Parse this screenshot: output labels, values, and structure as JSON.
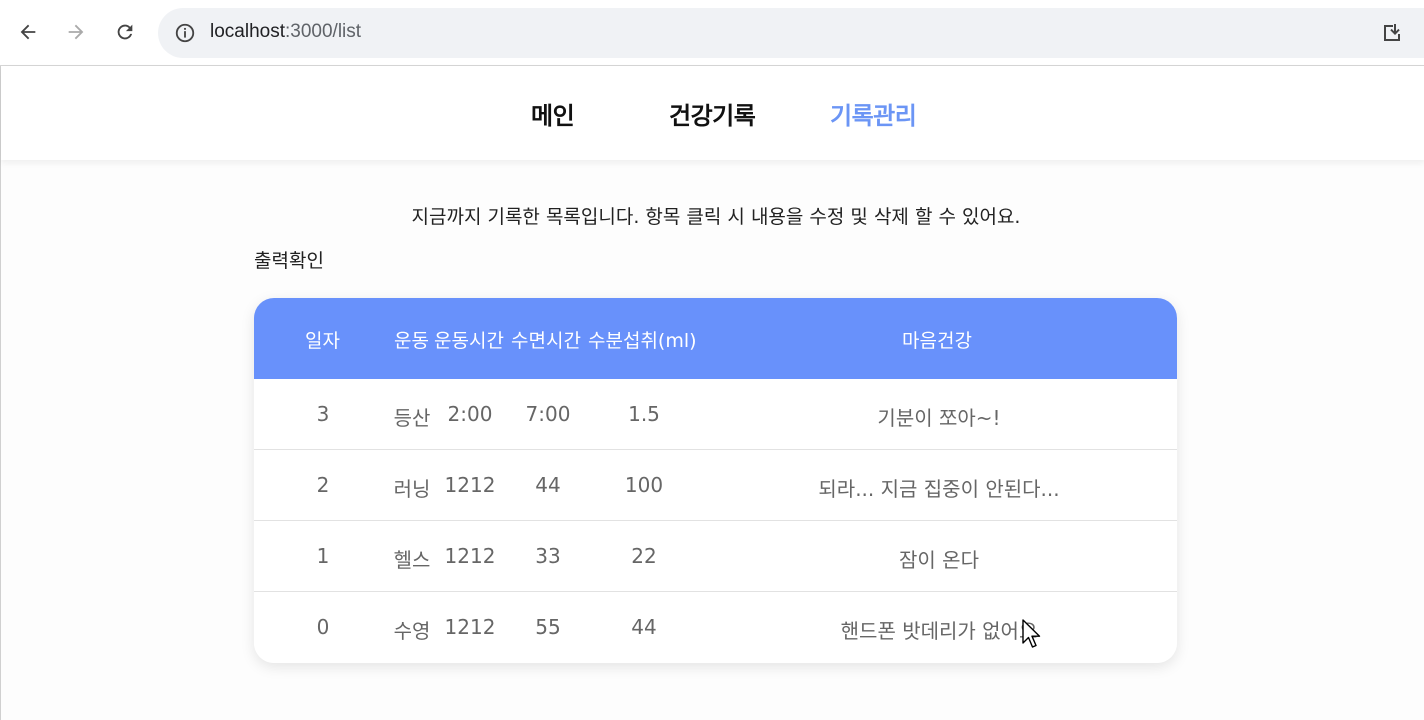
{
  "browser": {
    "url_host": "localhost",
    "url_path": ":3000/list",
    "icons": {
      "back": "back-arrow-icon",
      "forward": "forward-arrow-icon",
      "reload": "reload-icon",
      "info": "info-icon",
      "install": "install-app-icon"
    }
  },
  "nav": {
    "items": [
      {
        "label": "메인",
        "active": false
      },
      {
        "label": "건강기록",
        "active": false
      },
      {
        "label": "기록관리",
        "active": true
      }
    ],
    "active_color": "#6b95f5"
  },
  "description": "지금까지 기록한 목록입니다. 항목 클릭 시 내용을 수정 및 삭제 할 수 있어요.",
  "print_check": "출력확인",
  "table": {
    "header_color": "#6891fb",
    "headers": [
      "일자",
      "운동",
      "운동시간",
      "수면시간",
      "수분섭취(ml)",
      "마음건강"
    ],
    "rows": [
      [
        "3",
        "등산",
        "2:00",
        "7:00",
        "1.5",
        "기분이 쪼아~!"
      ],
      [
        "2",
        "러닝",
        "1212",
        "44",
        "100",
        "되라... 지금 집중이 안된다..."
      ],
      [
        "1",
        "헬스",
        "1212",
        "33",
        "22",
        "잠이 온다"
      ],
      [
        "0",
        "수영",
        "1212",
        "55",
        "44",
        "핸드폰 밧데리가 없어요"
      ]
    ]
  }
}
